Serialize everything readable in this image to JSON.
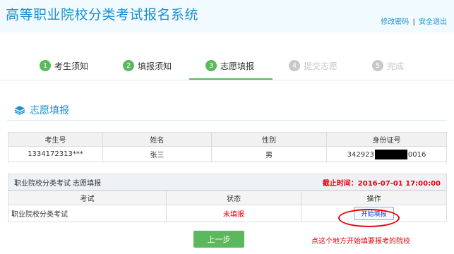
{
  "header": {
    "title": "高等职业院校分类考试报名系统",
    "change_password": "修改密码",
    "separator": "|",
    "logout": "安全退出"
  },
  "steps": [
    {
      "num": "1",
      "label": "考生须知",
      "state": "done"
    },
    {
      "num": "2",
      "label": "填报须知",
      "state": "done"
    },
    {
      "num": "3",
      "label": "志愿填报",
      "state": "done"
    },
    {
      "num": "4",
      "label": "提交志愿",
      "state": "todo"
    },
    {
      "num": "5",
      "label": "完成",
      "state": "todo"
    }
  ],
  "section": {
    "title": "志愿填报",
    "icon": "layers-icon"
  },
  "info_table": {
    "headers": [
      "考生号",
      "姓名",
      "性别",
      "身份证号"
    ],
    "row": {
      "exam_no": "1334172313***",
      "name": "张三",
      "gender": "男",
      "id_prefix": "342923",
      "id_suffix": "0016"
    }
  },
  "apply": {
    "bar_title": "职业院校分类考试 志愿填报",
    "deadline": "截止时间：2016-07-01 17:00:00",
    "headers": [
      "考试",
      "状态",
      "操作"
    ],
    "row": {
      "exam": "职业院校分类考试",
      "status": "未填报",
      "action": "开始填报"
    }
  },
  "prev_button": "上一步",
  "hint": "点这个地方开始填要报考的院校",
  "colors": {
    "accent": "#1a8fd1",
    "success": "#5cb85c",
    "alert": "#e8000b"
  }
}
